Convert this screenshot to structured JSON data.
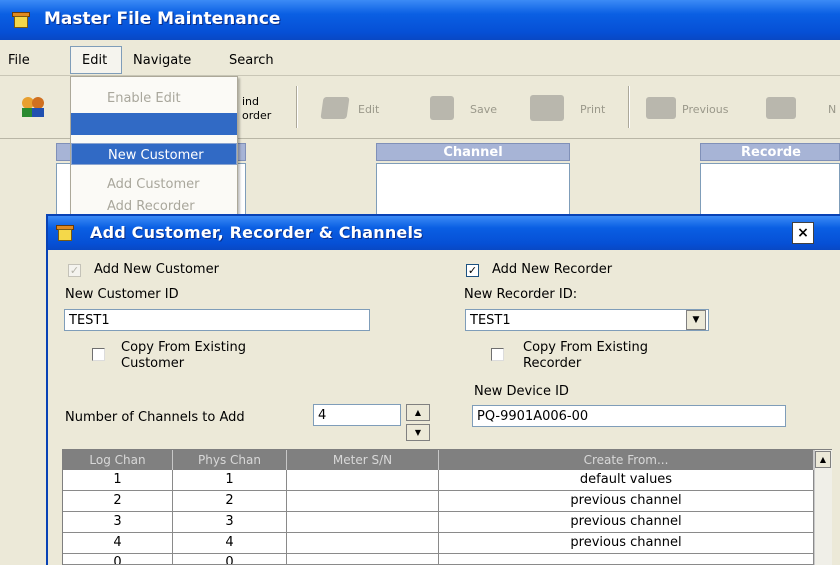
{
  "main_window": {
    "title": "Master File Maintenance"
  },
  "menubar": {
    "items": [
      "File",
      "Edit",
      "Navigate",
      "Search"
    ]
  },
  "toolbar": {
    "find_recorder": [
      "ind",
      "order"
    ],
    "buttons": [
      "Edit",
      "Save",
      "Print",
      "Previous"
    ],
    "next_partial": "N"
  },
  "panels": {
    "channel": "Channel",
    "recorder": "Recorde"
  },
  "edit_menu": {
    "items": [
      {
        "label": "Enable Edit",
        "state": "disabled"
      },
      {
        "label": "",
        "state": "highlighted"
      },
      {
        "label": "New Customer",
        "state": "hover"
      },
      {
        "label": "Add Customer",
        "state": "disabled"
      },
      {
        "label": "Add Recorder",
        "state": "disabled"
      }
    ]
  },
  "dialog": {
    "title": "Add Customer, Recorder & Channels",
    "close": "×",
    "add_new_customer": {
      "label": "Add New Customer",
      "checked": true,
      "enabled": false
    },
    "new_customer_id": {
      "label": "New Customer ID",
      "value": "TEST1"
    },
    "copy_existing_customer": {
      "label_line1": "Copy From Existing",
      "label_line2": "Customer",
      "checked": false
    },
    "add_new_recorder": {
      "label": "Add New Recorder",
      "checked": true
    },
    "new_recorder_id": {
      "label": "New Recorder ID:",
      "value": "TEST1"
    },
    "copy_existing_recorder": {
      "label_line1": "Copy From Existing",
      "label_line2": "Recorder",
      "checked": false
    },
    "new_device_id": {
      "label": "New Device ID",
      "value": "PQ-9901A006-00"
    },
    "num_channels": {
      "label": "Number of Channels to Add",
      "value": "4"
    },
    "grid": {
      "columns": [
        "Log Chan",
        "Phys Chan",
        "Meter S/N",
        "Create From..."
      ],
      "rows": [
        [
          "1",
          "1",
          "",
          "default values"
        ],
        [
          "2",
          "2",
          "",
          "previous channel"
        ],
        [
          "3",
          "3",
          "",
          "previous channel"
        ],
        [
          "4",
          "4",
          "",
          "previous channel"
        ],
        [
          "0",
          "0",
          "",
          ""
        ]
      ]
    }
  },
  "colors": {
    "title_blue": "#0650d6",
    "menu_highlight": "#316ac5",
    "grid_header": "#808080",
    "panel_header": "#a7b4d6"
  },
  "icons": {
    "app": "app-box-icon",
    "users": "users-icon",
    "edit": "edit-icon",
    "save": "save-icon",
    "print": "printer-icon",
    "previous": "previous-arrow-icon",
    "next": "next-arrow-icon",
    "close": "close-icon",
    "dropdown": "chevron-down-icon",
    "spin_up": "arrow-up-icon",
    "spin_down": "arrow-down-icon"
  }
}
